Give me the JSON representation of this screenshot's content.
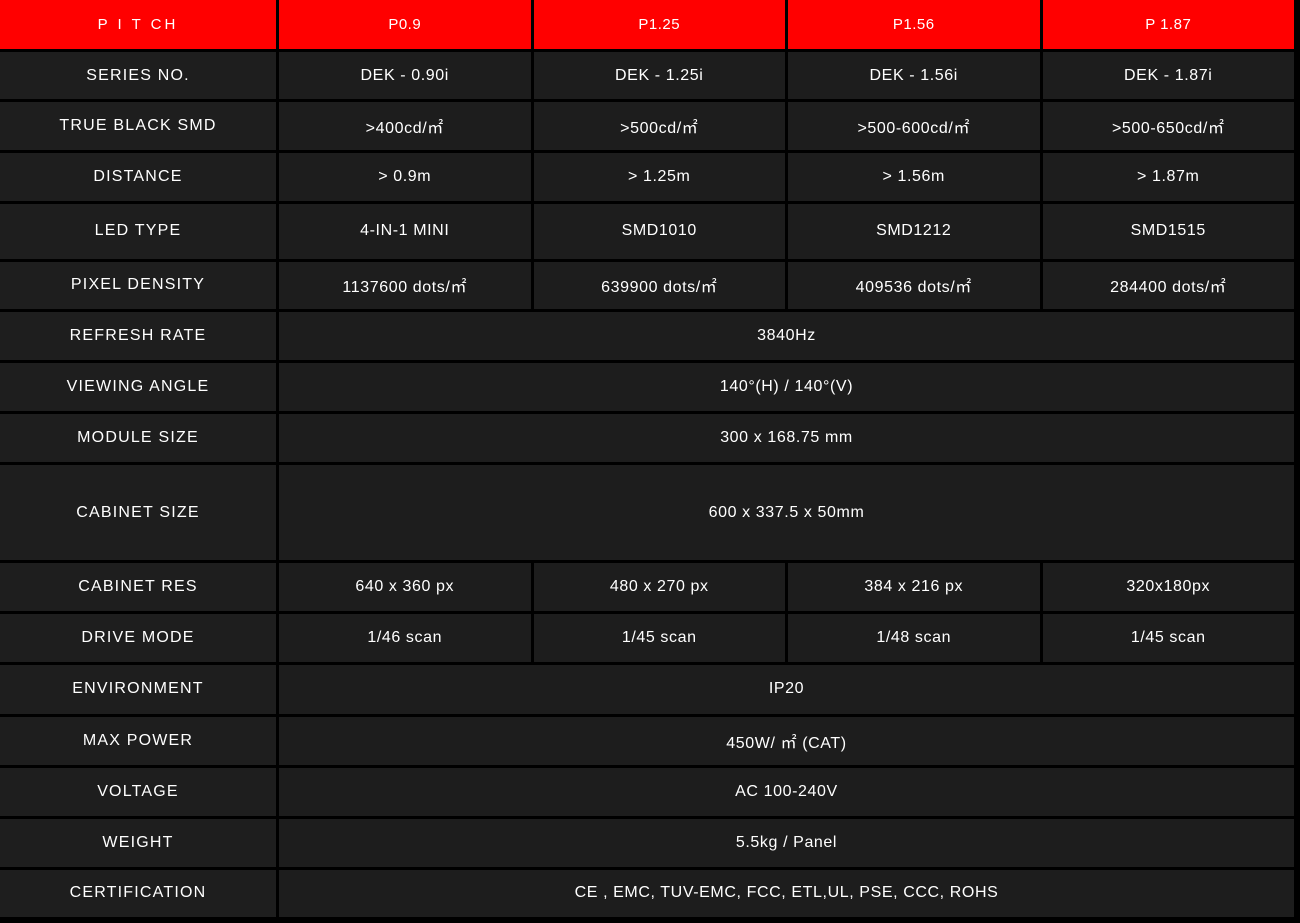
{
  "header": {
    "label": "P I T CH",
    "columns": [
      "P0.9",
      "P1.25",
      "P1.56",
      "P 1.87"
    ]
  },
  "rows": [
    {
      "label": "SERIES NO.",
      "values": [
        "DEK - 0.90i",
        "DEK - 1.25i",
        "DEK - 1.56i",
        "DEK - 1.87i"
      ]
    },
    {
      "label": "TRUE BLACK SMD",
      "values": [
        ">400cd/㎡",
        ">500cd/㎡",
        ">500-600cd/㎡",
        ">500-650cd/㎡"
      ]
    },
    {
      "label": "DISTANCE",
      "values": [
        "> 0.9m",
        "> 1.25m",
        "> 1.56m",
        "> 1.87m"
      ]
    },
    {
      "label": "LED TYPE",
      "values": [
        "4-IN-1 MINI",
        "SMD1010",
        "SMD1212",
        "SMD1515"
      ]
    },
    {
      "label": "PIXEL DENSITY",
      "values": [
        "1137600 dots/㎡",
        "639900 dots/㎡",
        "409536 dots/㎡",
        "284400 dots/㎡"
      ]
    },
    {
      "label": "REFRESH RATE",
      "value": "3840Hz"
    },
    {
      "label": "VIEWING ANGLE",
      "value": "140°(H) / 140°(V)"
    },
    {
      "label": "MODULE SIZE",
      "value": "300 x 168.75 mm"
    },
    {
      "label": "CABINET SIZE",
      "value": "600 x 337.5 x 50mm"
    },
    {
      "label": "CABINET RES",
      "values": [
        "640 x 360 px",
        "480 x 270 px",
        "384 x 216 px",
        "320x180px"
      ]
    },
    {
      "label": "DRIVE MODE",
      "values": [
        "1/46 scan",
        "1/45 scan",
        "1/48 scan",
        "1/45 scan"
      ]
    },
    {
      "label": "ENVIRONMENT",
      "value": "IP20"
    },
    {
      "label": "MAX POWER",
      "value": "450W/ ㎡ (CAT)"
    },
    {
      "label": "VOLTAGE",
      "value": "AC 100-240V"
    },
    {
      "label": "WEIGHT",
      "value": "5.5kg / Panel"
    },
    {
      "label": "CERTIFICATION",
      "value": "CE , EMC, TUV-EMC, FCC, ETL,UL, PSE, CCC, ROHS"
    }
  ],
  "colors": {
    "header_bg": "#ff0000",
    "cell_bg": "#1d1d1d",
    "grid_line": "#000000",
    "text": "#ffffff"
  }
}
